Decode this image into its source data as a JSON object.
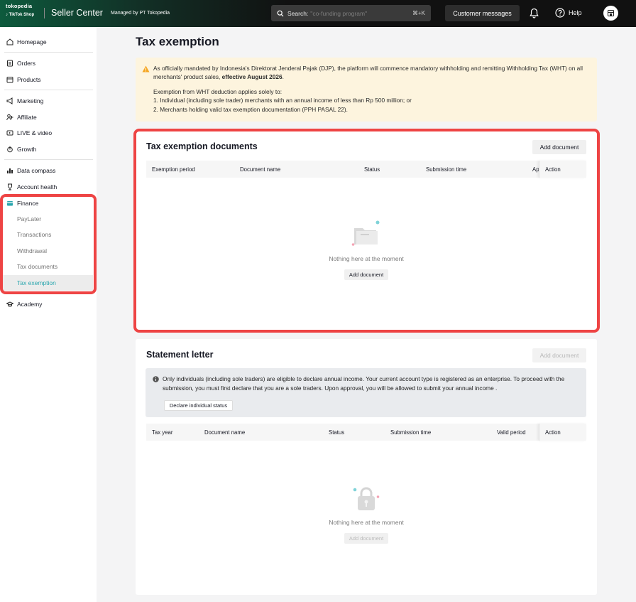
{
  "topbar": {
    "brand_top": "tokopedia",
    "brand_bottom": "TikTok Shop",
    "title": "Seller Center",
    "managed_by": "Managed by PT Tokopedia",
    "search_label": "Search:",
    "search_placeholder": "\"co-funding program\"",
    "search_shortcut": "⌘+K",
    "customer_messages": "Customer messages",
    "help": "Help"
  },
  "sidebar": {
    "items": [
      {
        "label": "Homepage",
        "icon": "home-icon"
      },
      {
        "label": "Orders",
        "icon": "orders-icon"
      },
      {
        "label": "Products",
        "icon": "products-icon"
      },
      {
        "label": "Marketing",
        "icon": "megaphone-icon"
      },
      {
        "label": "Affiliate",
        "icon": "affiliate-icon"
      },
      {
        "label": "LIVE & video",
        "icon": "video-icon"
      },
      {
        "label": "Growth",
        "icon": "growth-icon"
      },
      {
        "label": "Data compass",
        "icon": "chart-icon"
      },
      {
        "label": "Account health",
        "icon": "trophy-icon"
      },
      {
        "label": "Finance",
        "icon": "wallet-icon"
      },
      {
        "label": "Academy",
        "icon": "graduation-cap-icon"
      }
    ],
    "finance_sub": [
      "PayLater",
      "Transactions",
      "Withdrawal",
      "Tax documents",
      "Tax exemption"
    ],
    "active_sub": "Tax exemption"
  },
  "main": {
    "page_title": "Tax exemption",
    "alert": {
      "line1_pre": "As officially mandated by Indonesia's Direktorat Jenderal Pajak (DJP), the platform will commence mandatory withholding and remitting Withholding Tax (WHT) on all merchants' product sales, ",
      "line1_bold": "effective August 2026",
      "line1_post": ".",
      "intro": "Exemption from WHT deduction applies solely to:",
      "point1": "1.  Individual (including sole trader) merchants with an annual income of less than Rp 500 million; or",
      "point2": "2.  Merchants holding valid tax exemption documentation (PPH PASAL 22)."
    },
    "exemption_docs": {
      "title": "Tax exemption documents",
      "add_button": "Add document",
      "columns": [
        "Exemption period",
        "Document name",
        "Status",
        "Submission time",
        "Ap",
        "Action"
      ],
      "empty_text": "Nothing here at the moment",
      "empty_button": "Add document"
    },
    "statement": {
      "title": "Statement letter",
      "add_button": "Add document",
      "info": "Only individuals (including sole traders) are eligible to declare annual income. Your current account type is registered as an enterprise. To proceed with the submission, you must first declare that you are a sole traders. Upon approval, you will be allowed to submit your annual income .",
      "declare_button": "Declare individual status",
      "columns": [
        "Tax year",
        "Document name",
        "Status",
        "Submission time",
        "Valid period",
        "Action"
      ],
      "empty_text": "Nothing here at the moment",
      "empty_button": "Add document"
    }
  },
  "colors": {
    "accent": "#27a5ad",
    "highlight": "#ee4444",
    "warning": "#f5a623"
  }
}
